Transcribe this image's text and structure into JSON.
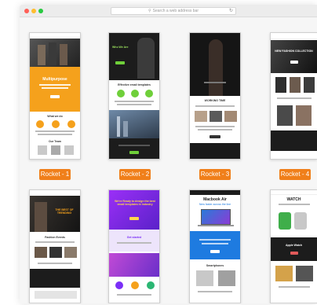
{
  "browser": {
    "search_placeholder": "Search a web address bar"
  },
  "labels": [
    "Rocket - 1",
    "Rocket - 2",
    "Rocket - 3",
    "Rocket - 4"
  ],
  "templates": {
    "t1_heading": "Multipurpose",
    "t1_section": "What we do",
    "t1_team": "Our Team",
    "t2_heading": "Who We Are",
    "t2_section": "Effective email templates",
    "t3_section": "WORKING TIME",
    "t4_heading": "NEW FASHION COLLECTION",
    "t5_heading": "THE BEST OF TRENDING",
    "t5_section": "Fashion Events",
    "t6_heading": "We're Ready to design the best email templates in industry",
    "t6_section": "Get started",
    "t7_heading": "Macbook Air",
    "t7_sub": "New faster across the line",
    "t7_section": "Smartphones",
    "t8_heading": "WATCH",
    "t8_section": "Apple Watch"
  },
  "colors": {
    "accent": "#f07f1a",
    "dark": "#1c1c1c",
    "purple": "#7b2ff7",
    "blue": "#1e7be0"
  }
}
